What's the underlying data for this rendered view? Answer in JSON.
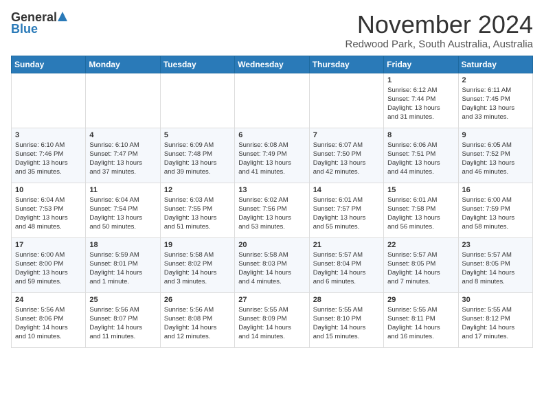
{
  "header": {
    "logo_general": "General",
    "logo_blue": "Blue",
    "month_title": "November 2024",
    "location": "Redwood Park, South Australia, Australia"
  },
  "weekdays": [
    "Sunday",
    "Monday",
    "Tuesday",
    "Wednesday",
    "Thursday",
    "Friday",
    "Saturday"
  ],
  "weeks": [
    [
      {
        "day": "",
        "info": ""
      },
      {
        "day": "",
        "info": ""
      },
      {
        "day": "",
        "info": ""
      },
      {
        "day": "",
        "info": ""
      },
      {
        "day": "",
        "info": ""
      },
      {
        "day": "1",
        "info": "Sunrise: 6:12 AM\nSunset: 7:44 PM\nDaylight: 13 hours\nand 31 minutes."
      },
      {
        "day": "2",
        "info": "Sunrise: 6:11 AM\nSunset: 7:45 PM\nDaylight: 13 hours\nand 33 minutes."
      }
    ],
    [
      {
        "day": "3",
        "info": "Sunrise: 6:10 AM\nSunset: 7:46 PM\nDaylight: 13 hours\nand 35 minutes."
      },
      {
        "day": "4",
        "info": "Sunrise: 6:10 AM\nSunset: 7:47 PM\nDaylight: 13 hours\nand 37 minutes."
      },
      {
        "day": "5",
        "info": "Sunrise: 6:09 AM\nSunset: 7:48 PM\nDaylight: 13 hours\nand 39 minutes."
      },
      {
        "day": "6",
        "info": "Sunrise: 6:08 AM\nSunset: 7:49 PM\nDaylight: 13 hours\nand 41 minutes."
      },
      {
        "day": "7",
        "info": "Sunrise: 6:07 AM\nSunset: 7:50 PM\nDaylight: 13 hours\nand 42 minutes."
      },
      {
        "day": "8",
        "info": "Sunrise: 6:06 AM\nSunset: 7:51 PM\nDaylight: 13 hours\nand 44 minutes."
      },
      {
        "day": "9",
        "info": "Sunrise: 6:05 AM\nSunset: 7:52 PM\nDaylight: 13 hours\nand 46 minutes."
      }
    ],
    [
      {
        "day": "10",
        "info": "Sunrise: 6:04 AM\nSunset: 7:53 PM\nDaylight: 13 hours\nand 48 minutes."
      },
      {
        "day": "11",
        "info": "Sunrise: 6:04 AM\nSunset: 7:54 PM\nDaylight: 13 hours\nand 50 minutes."
      },
      {
        "day": "12",
        "info": "Sunrise: 6:03 AM\nSunset: 7:55 PM\nDaylight: 13 hours\nand 51 minutes."
      },
      {
        "day": "13",
        "info": "Sunrise: 6:02 AM\nSunset: 7:56 PM\nDaylight: 13 hours\nand 53 minutes."
      },
      {
        "day": "14",
        "info": "Sunrise: 6:01 AM\nSunset: 7:57 PM\nDaylight: 13 hours\nand 55 minutes."
      },
      {
        "day": "15",
        "info": "Sunrise: 6:01 AM\nSunset: 7:58 PM\nDaylight: 13 hours\nand 56 minutes."
      },
      {
        "day": "16",
        "info": "Sunrise: 6:00 AM\nSunset: 7:59 PM\nDaylight: 13 hours\nand 58 minutes."
      }
    ],
    [
      {
        "day": "17",
        "info": "Sunrise: 6:00 AM\nSunset: 8:00 PM\nDaylight: 13 hours\nand 59 minutes."
      },
      {
        "day": "18",
        "info": "Sunrise: 5:59 AM\nSunset: 8:01 PM\nDaylight: 14 hours\nand 1 minute."
      },
      {
        "day": "19",
        "info": "Sunrise: 5:58 AM\nSunset: 8:02 PM\nDaylight: 14 hours\nand 3 minutes."
      },
      {
        "day": "20",
        "info": "Sunrise: 5:58 AM\nSunset: 8:03 PM\nDaylight: 14 hours\nand 4 minutes."
      },
      {
        "day": "21",
        "info": "Sunrise: 5:57 AM\nSunset: 8:04 PM\nDaylight: 14 hours\nand 6 minutes."
      },
      {
        "day": "22",
        "info": "Sunrise: 5:57 AM\nSunset: 8:05 PM\nDaylight: 14 hours\nand 7 minutes."
      },
      {
        "day": "23",
        "info": "Sunrise: 5:57 AM\nSunset: 8:05 PM\nDaylight: 14 hours\nand 8 minutes."
      }
    ],
    [
      {
        "day": "24",
        "info": "Sunrise: 5:56 AM\nSunset: 8:06 PM\nDaylight: 14 hours\nand 10 minutes."
      },
      {
        "day": "25",
        "info": "Sunrise: 5:56 AM\nSunset: 8:07 PM\nDaylight: 14 hours\nand 11 minutes."
      },
      {
        "day": "26",
        "info": "Sunrise: 5:56 AM\nSunset: 8:08 PM\nDaylight: 14 hours\nand 12 minutes."
      },
      {
        "day": "27",
        "info": "Sunrise: 5:55 AM\nSunset: 8:09 PM\nDaylight: 14 hours\nand 14 minutes."
      },
      {
        "day": "28",
        "info": "Sunrise: 5:55 AM\nSunset: 8:10 PM\nDaylight: 14 hours\nand 15 minutes."
      },
      {
        "day": "29",
        "info": "Sunrise: 5:55 AM\nSunset: 8:11 PM\nDaylight: 14 hours\nand 16 minutes."
      },
      {
        "day": "30",
        "info": "Sunrise: 5:55 AM\nSunset: 8:12 PM\nDaylight: 14 hours\nand 17 minutes."
      }
    ]
  ]
}
